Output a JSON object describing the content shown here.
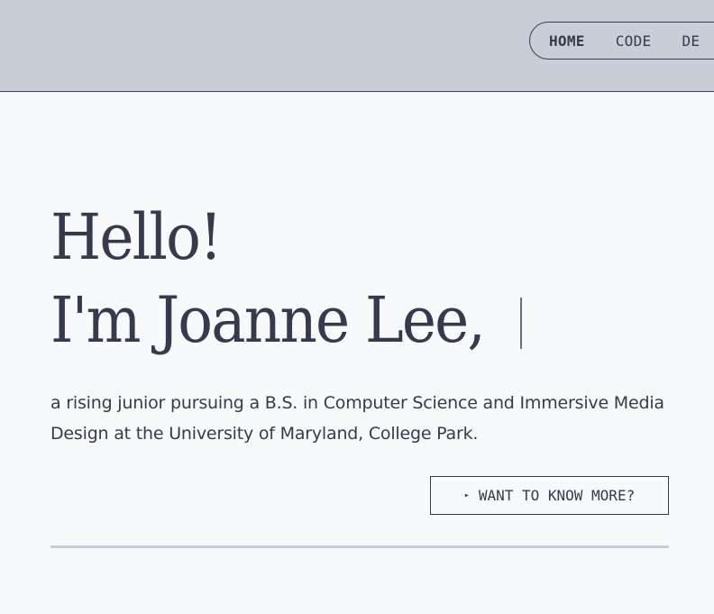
{
  "nav": {
    "items": [
      {
        "label": "HOME",
        "active": true
      },
      {
        "label": "CODE",
        "active": false
      },
      {
        "label": "DE",
        "active": false
      }
    ]
  },
  "hero": {
    "greeting": "Hello!",
    "name_line": "I'm Joanne Lee,",
    "description": "a rising junior pursuing a B.S. in Computer Science and Immersive Media Design at the University of Maryland, College Park."
  },
  "cta": {
    "arrow": "▸",
    "label": "WANT TO KNOW MORE?"
  },
  "colors": {
    "header_bg": "#c9cdd7",
    "text": "#353b4c",
    "page_bg": "#f8f9fa"
  }
}
